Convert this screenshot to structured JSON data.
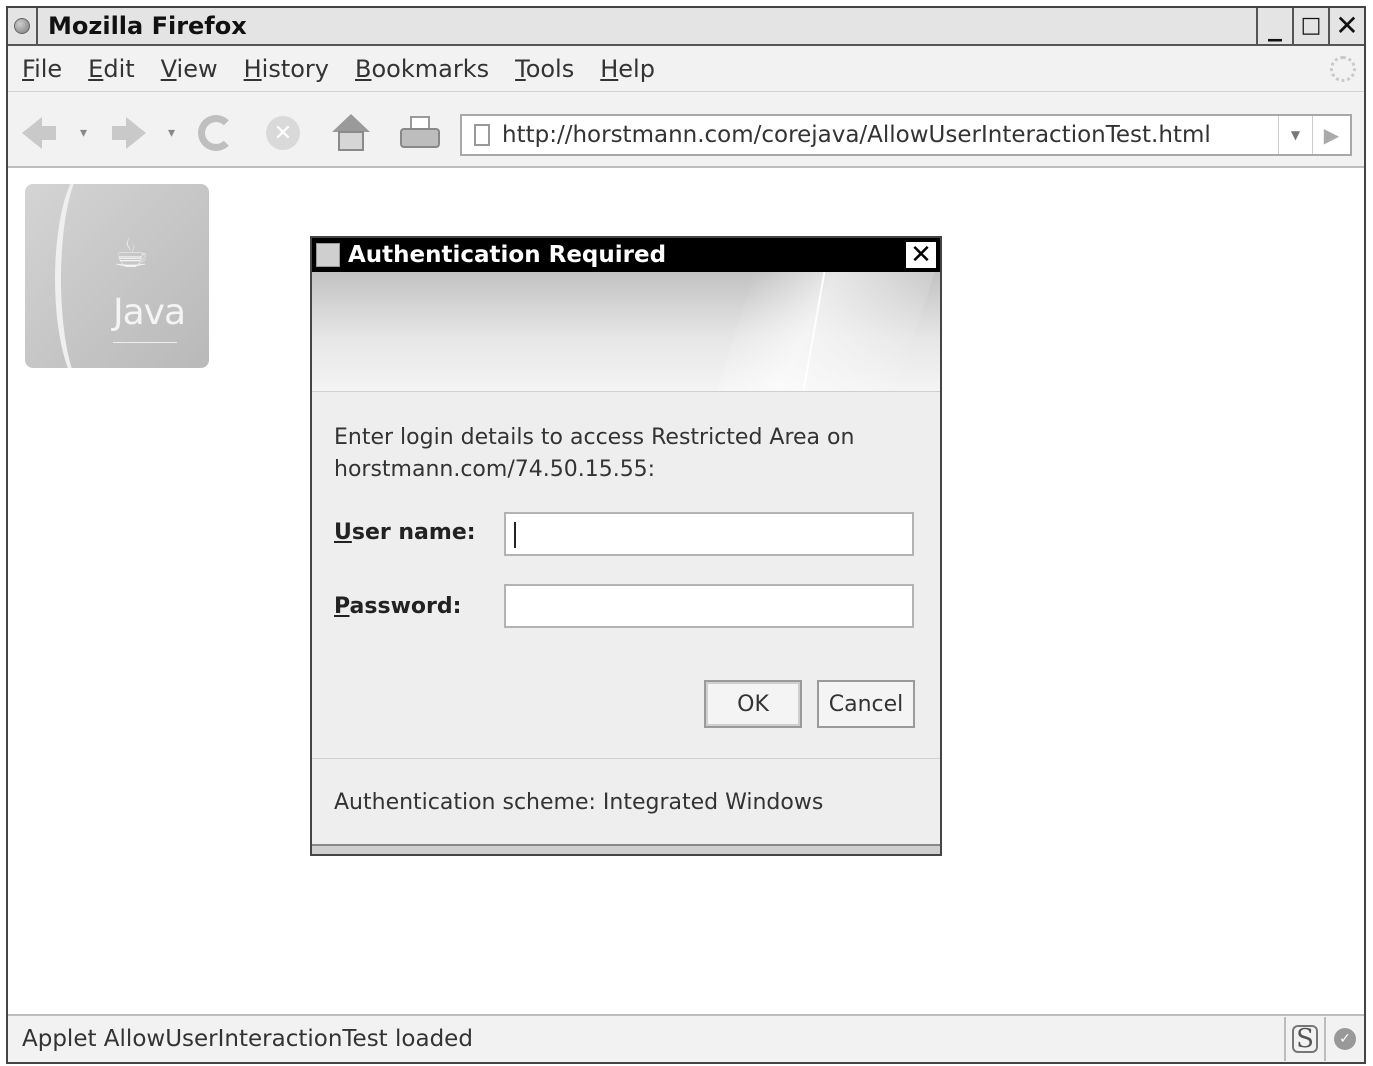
{
  "window": {
    "title": "Mozilla Firefox",
    "minimize_label": "_",
    "maximize_label": "□",
    "close_label": "✕"
  },
  "menu": {
    "items": [
      "File",
      "Edit",
      "View",
      "History",
      "Bookmarks",
      "Tools",
      "Help"
    ]
  },
  "navbar": {
    "url": "http://horstmann.com/corejava/AllowUserInteractionTest.html",
    "back_icon": "back-arrow-icon",
    "forward_icon": "forward-arrow-icon",
    "reload_icon": "reload-icon",
    "stop_icon": "stop-icon",
    "home_icon": "home-icon",
    "print_icon": "print-icon"
  },
  "content": {
    "logo_text": "Java"
  },
  "dialog": {
    "title": "Authentication Required",
    "close_label": "✕",
    "message": "Enter login details to access Restricted Area on horstmann.com/74.50.15.55:",
    "username_label": "ser name:",
    "username_mnemonic": "U",
    "username_value": "",
    "password_label": "assword:",
    "password_mnemonic": "P",
    "password_value": "",
    "ok_label": "OK",
    "cancel_label": "Cancel",
    "footer": "Authentication scheme: Integrated Windows"
  },
  "status": {
    "text": "Applet AllowUserInteractionTest loaded",
    "icon1": "S",
    "icon2": "✓"
  }
}
